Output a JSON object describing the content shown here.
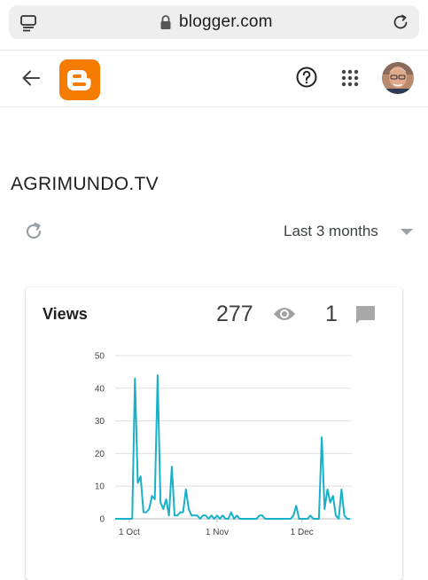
{
  "browser": {
    "url": "blogger.com",
    "icons": [
      "reader-icon",
      "lock-icon",
      "reload-icon"
    ]
  },
  "header": {
    "icons": [
      "back-arrow-icon",
      "blogger-logo-icon",
      "help-icon",
      "apps-grid-icon",
      "avatar"
    ]
  },
  "blog": {
    "title": "AGRIMUNDO.TV"
  },
  "controls": {
    "range_label": "Last 3 months"
  },
  "stats": {
    "card_title": "Views",
    "views": "277",
    "comments": "1"
  },
  "colors": {
    "accent": "#19b1c7",
    "blogger_orange": "#f57c00"
  },
  "chart_data": {
    "type": "line",
    "title": "",
    "xlabel": "",
    "ylabel": "",
    "ylim": [
      0,
      50
    ],
    "yticks": [
      "0",
      "10",
      "20",
      "30",
      "40",
      "50"
    ],
    "xticks": [
      {
        "label": "1 Oct",
        "day": 5
      },
      {
        "label": "1 Nov",
        "day": 36
      },
      {
        "label": "1 Dec",
        "day": 66
      }
    ],
    "grid": true,
    "series": [
      {
        "values": [
          0,
          0,
          0,
          0,
          0,
          0,
          0,
          43,
          11,
          13,
          2,
          2,
          3,
          7,
          6,
          44,
          5,
          3,
          6,
          1,
          16,
          1,
          1,
          2,
          2,
          9,
          3,
          1,
          1,
          1,
          0,
          1,
          1,
          0,
          1,
          0,
          1,
          0,
          1,
          0,
          0,
          2,
          0,
          1,
          0,
          0,
          0,
          0,
          0,
          0,
          0,
          1,
          1,
          0,
          0,
          0,
          0,
          0,
          0,
          0,
          0,
          0,
          0,
          1,
          4,
          0,
          0,
          0,
          0,
          1,
          0,
          0,
          0,
          25,
          3,
          9,
          5,
          7,
          1,
          0,
          9,
          1,
          0,
          0
        ]
      }
    ]
  }
}
